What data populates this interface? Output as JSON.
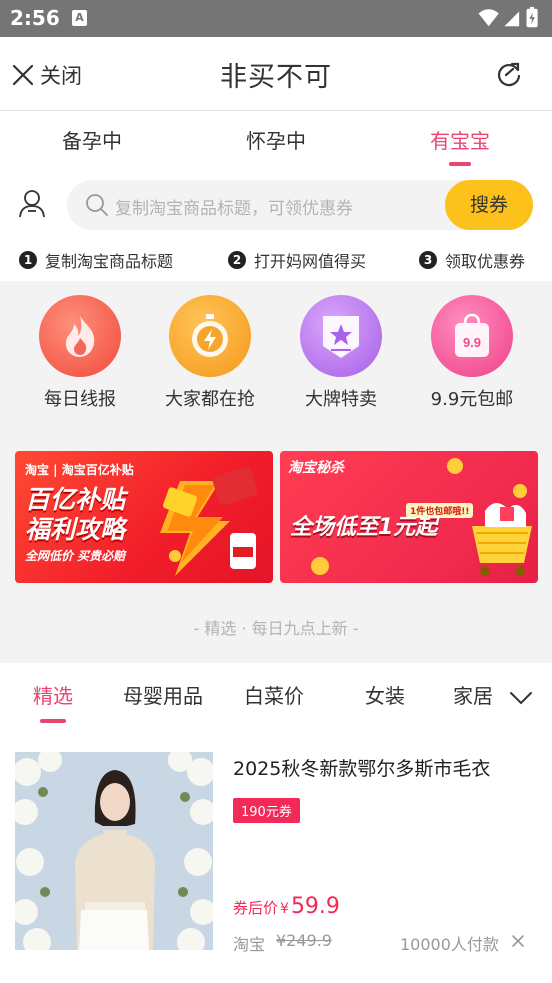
{
  "status_bar": {
    "time": "2:56",
    "a_label": "A"
  },
  "header": {
    "close_label": "关闭",
    "title": "非买不可"
  },
  "stage_tabs": [
    {
      "label": "备孕中"
    },
    {
      "label": "怀孕中"
    },
    {
      "label": "有宝宝",
      "active": true
    }
  ],
  "search": {
    "placeholder": "复制淘宝商品标题，可领优惠券",
    "button_label": "搜券"
  },
  "steps": [
    {
      "num": "1",
      "label": "复制淘宝商品标题"
    },
    {
      "num": "2",
      "label": "打开妈网值得买"
    },
    {
      "num": "3",
      "label": "领取优惠券"
    }
  ],
  "categories": [
    {
      "label": "每日线报",
      "icon": "flame-icon",
      "color": "#f35a4f"
    },
    {
      "label": "大家都在抢",
      "icon": "stopwatch-icon",
      "color": "#f9a228"
    },
    {
      "label": "大牌特卖",
      "icon": "badge-star-icon",
      "color": "#b774ec"
    },
    {
      "label": "9.9元包邮",
      "icon": "shopping-bag-icon",
      "color": "#f2508f",
      "icon_text": "9.9"
    }
  ],
  "banners": {
    "left": {
      "tag": "淘宝 | 淘宝百亿补贴",
      "title_line1": "百亿补贴",
      "title_line2": "福利攻略",
      "subtitle": "全网低价 买贵必赔"
    },
    "right": {
      "tag": "淘宝秘杀",
      "pill": "1件也包邮哦!!",
      "title": "全场低至1元起"
    }
  },
  "daily_note": "- 精选 · 每日九点上新 -",
  "feed_tabs": [
    {
      "label": "精选",
      "active": true
    },
    {
      "label": "母婴用品"
    },
    {
      "label": "白菜价"
    },
    {
      "label": "女装"
    },
    {
      "label": "家居"
    }
  ],
  "product": {
    "title": "2025秋冬新款鄂尔多斯市毛衣",
    "coupon_badge": "190元券",
    "price_label": "券后价",
    "currency": "¥",
    "price": "59.9",
    "source": "淘宝",
    "original_price": "¥249.9",
    "sold": "10000人付款"
  },
  "colors": {
    "accent": "#e9456f",
    "coupon_button": "#fcc21b",
    "price": "#f22a58"
  }
}
